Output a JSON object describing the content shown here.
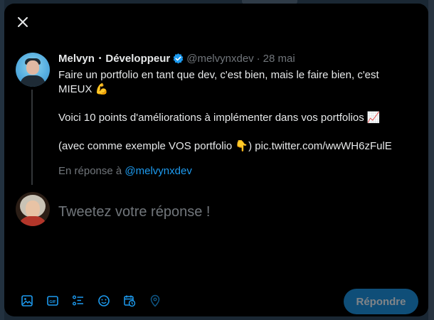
{
  "modal": {
    "close_icon": "close-icon"
  },
  "tweet": {
    "author_name": "Melvyn",
    "separator": "•",
    "author_title": "Développeur",
    "handle": "@melvynxdev",
    "date": "28 mai",
    "lines": [
      "Faire un portfolio en tant que dev, c'est bien, mais le faire bien, c'est MIEUX 💪",
      "Voici 10 points d'améliorations à implémenter dans vos portfolios 📈",
      "(avec comme exemple VOS portfolio 👇) pic.twitter.com/wwWH6zFulE"
    ]
  },
  "reply_context": {
    "prefix": "En réponse à ",
    "mention": "@melvynxdev"
  },
  "composer": {
    "placeholder": "Tweetez votre réponse !",
    "submit_label": "Répondre"
  },
  "toolbar": {
    "tools": [
      "image-icon",
      "gif-icon",
      "poll-icon",
      "emoji-icon",
      "schedule-icon",
      "location-icon"
    ]
  },
  "colors": {
    "accent": "#1d9bf0",
    "text": "#e7e9ea",
    "muted": "#71767b",
    "button_disabled_bg": "#0f4e78"
  }
}
